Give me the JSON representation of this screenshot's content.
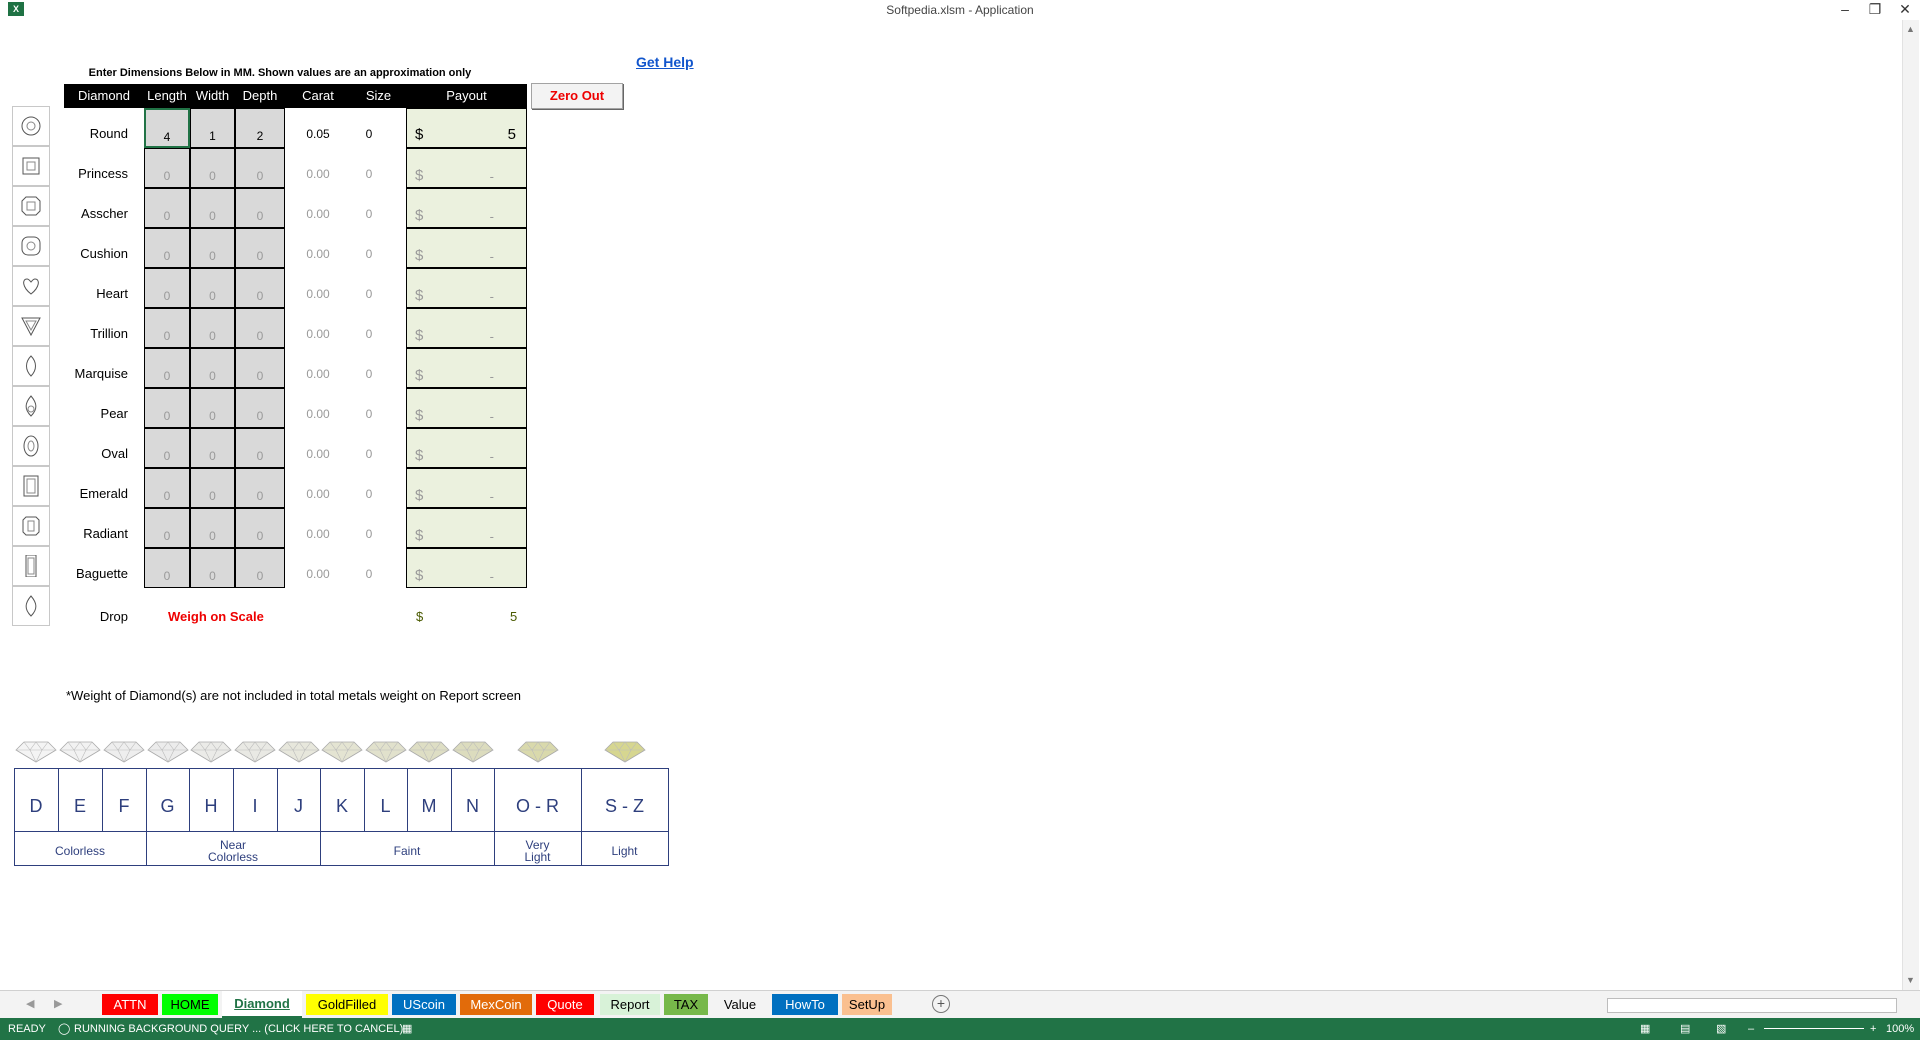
{
  "window": {
    "title": "Softpedia.xlsm - Application",
    "app_icon": "excel-icon"
  },
  "sheet": {
    "caption": "Enter Dimensions Below in MM. Shown values are an approximation only",
    "help_link": "Get Help",
    "headers": [
      "Diamond",
      "Length",
      "Width",
      "Depth",
      "Carat",
      "Size",
      "Payout"
    ],
    "zero_button": "Zero Out",
    "rows": [
      {
        "name": "Round",
        "length": "4",
        "width": "1",
        "depth": "2",
        "carat": "0.05",
        "size": "0",
        "dollar": "$",
        "payout": "5"
      },
      {
        "name": "Princess",
        "length": "0",
        "width": "0",
        "depth": "0",
        "carat": "0.00",
        "size": "0",
        "dollar": "$",
        "payout": "-"
      },
      {
        "name": "Asscher",
        "length": "0",
        "width": "0",
        "depth": "0",
        "carat": "0.00",
        "size": "0",
        "dollar": "$",
        "payout": "-"
      },
      {
        "name": "Cushion",
        "length": "0",
        "width": "0",
        "depth": "0",
        "carat": "0.00",
        "size": "0",
        "dollar": "$",
        "payout": "-"
      },
      {
        "name": "Heart",
        "length": "0",
        "width": "0",
        "depth": "0",
        "carat": "0.00",
        "size": "0",
        "dollar": "$",
        "payout": "-"
      },
      {
        "name": "Trillion",
        "length": "0",
        "width": "0",
        "depth": "0",
        "carat": "0.00",
        "size": "0",
        "dollar": "$",
        "payout": "-"
      },
      {
        "name": "Marquise",
        "length": "0",
        "width": "0",
        "depth": "0",
        "carat": "0.00",
        "size": "0",
        "dollar": "$",
        "payout": "-"
      },
      {
        "name": "Pear",
        "length": "0",
        "width": "0",
        "depth": "0",
        "carat": "0.00",
        "size": "0",
        "dollar": "$",
        "payout": "-"
      },
      {
        "name": "Oval",
        "length": "0",
        "width": "0",
        "depth": "0",
        "carat": "0.00",
        "size": "0",
        "dollar": "$",
        "payout": "-"
      },
      {
        "name": "Emerald",
        "length": "0",
        "width": "0",
        "depth": "0",
        "carat": "0.00",
        "size": "0",
        "dollar": "$",
        "payout": "-"
      },
      {
        "name": "Radiant",
        "length": "0",
        "width": "0",
        "depth": "0",
        "carat": "0.00",
        "size": "0",
        "dollar": "$",
        "payout": "-"
      },
      {
        "name": "Baguette",
        "length": "0",
        "width": "0",
        "depth": "0",
        "carat": "0.00",
        "size": "0",
        "dollar": "$",
        "payout": "-"
      }
    ],
    "drop": {
      "name": "Drop",
      "weigh": "Weigh on Scale",
      "dollar": "$",
      "value": "5"
    },
    "note": "*Weight of Diamond(s) are not included in total metals weight on Report screen",
    "color_grades": [
      "D",
      "E",
      "F",
      "G",
      "H",
      "I",
      "J",
      "K",
      "L",
      "M",
      "N",
      "O - R",
      "S - Z"
    ],
    "grade_categories": [
      {
        "line1": "Colorless",
        "line2": ""
      },
      {
        "line1": "Near",
        "line2": "Colorless"
      },
      {
        "line1": "Faint",
        "line2": ""
      },
      {
        "line1": "Very",
        "line2": "Light"
      },
      {
        "line1": "Light",
        "line2": ""
      }
    ]
  },
  "tabs": [
    {
      "label": "ATTN",
      "color": "#ff0000",
      "text": "#ffffff"
    },
    {
      "label": "HOME",
      "color": "#00ff00",
      "text": "#000000"
    },
    {
      "label": "Diamond",
      "color": "#ffffff",
      "text": "#217346"
    },
    {
      "label": "GoldFilled",
      "color": "#ffff00",
      "text": "#000000"
    },
    {
      "label": "UScoin",
      "color": "#0070c0",
      "text": "#ffffff"
    },
    {
      "label": "MexCoin",
      "color": "#e26b0a",
      "text": "#ffffff"
    },
    {
      "label": "Quote",
      "color": "#ff0000",
      "text": "#ffffff"
    },
    {
      "label": "Report",
      "color": "#d8f2d8",
      "text": "#000000"
    },
    {
      "label": "TAX",
      "color": "#77b84a",
      "text": "#000000"
    },
    {
      "label": "Value",
      "color": "#f3f3f3",
      "text": "#000000"
    },
    {
      "label": "HowTo",
      "color": "#0070c0",
      "text": "#ffffff"
    },
    {
      "label": "SetUp",
      "color": "#fac090",
      "text": "#000000"
    }
  ],
  "status": {
    "ready": "READY",
    "query": "RUNNING BACKGROUND QUERY ...   (CLICK HERE TO CANCEL)",
    "zoom": "100%"
  },
  "colors": {
    "status_bar": "#217346",
    "payout_fill": "#ebf1de",
    "input_fill": "#d9d9d9",
    "grade_blue": "#2e3f7d"
  }
}
